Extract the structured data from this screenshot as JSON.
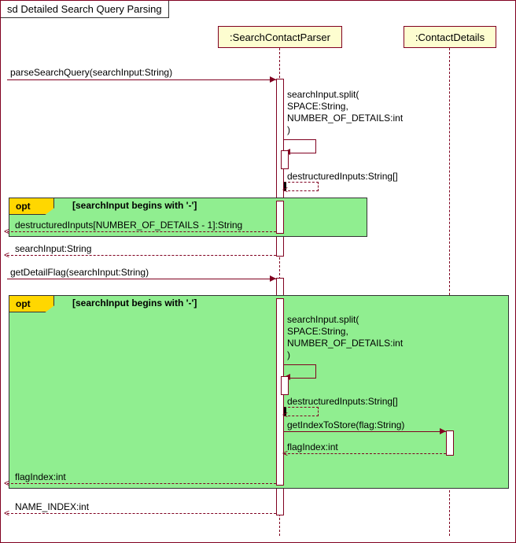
{
  "title": "sd Detailed Search Query Parsing",
  "participants": {
    "p1": ":SearchContactParser",
    "p2": ":ContactDetails"
  },
  "messages": {
    "m1": "parseSearchQuery(searchInput:String)",
    "m2_lines": [
      "searchInput.split(",
      "        SPACE:String,",
      "        NUMBER_OF_DETAILS:int",
      ")"
    ],
    "m3": "destructuredInputs:String[]",
    "m4": "destructuredInputs[NUMBER_OF_DETAILS - 1]:String",
    "m5": "searchInput:String",
    "m6": "getDetailFlag(searchInput:String)",
    "m7_lines": [
      "searchInput.split(",
      "        SPACE:String,",
      "        NUMBER_OF_DETAILS:int",
      ")"
    ],
    "m8": "destructuredInputs:String[]",
    "m9": "getIndexToStore(flag:String)",
    "m10": "flagIndex:int",
    "m11": "flagIndex:int",
    "m12": "NAME_INDEX:int"
  },
  "opt": {
    "tag": "opt",
    "cond": "[searchInput begins with '-']"
  }
}
